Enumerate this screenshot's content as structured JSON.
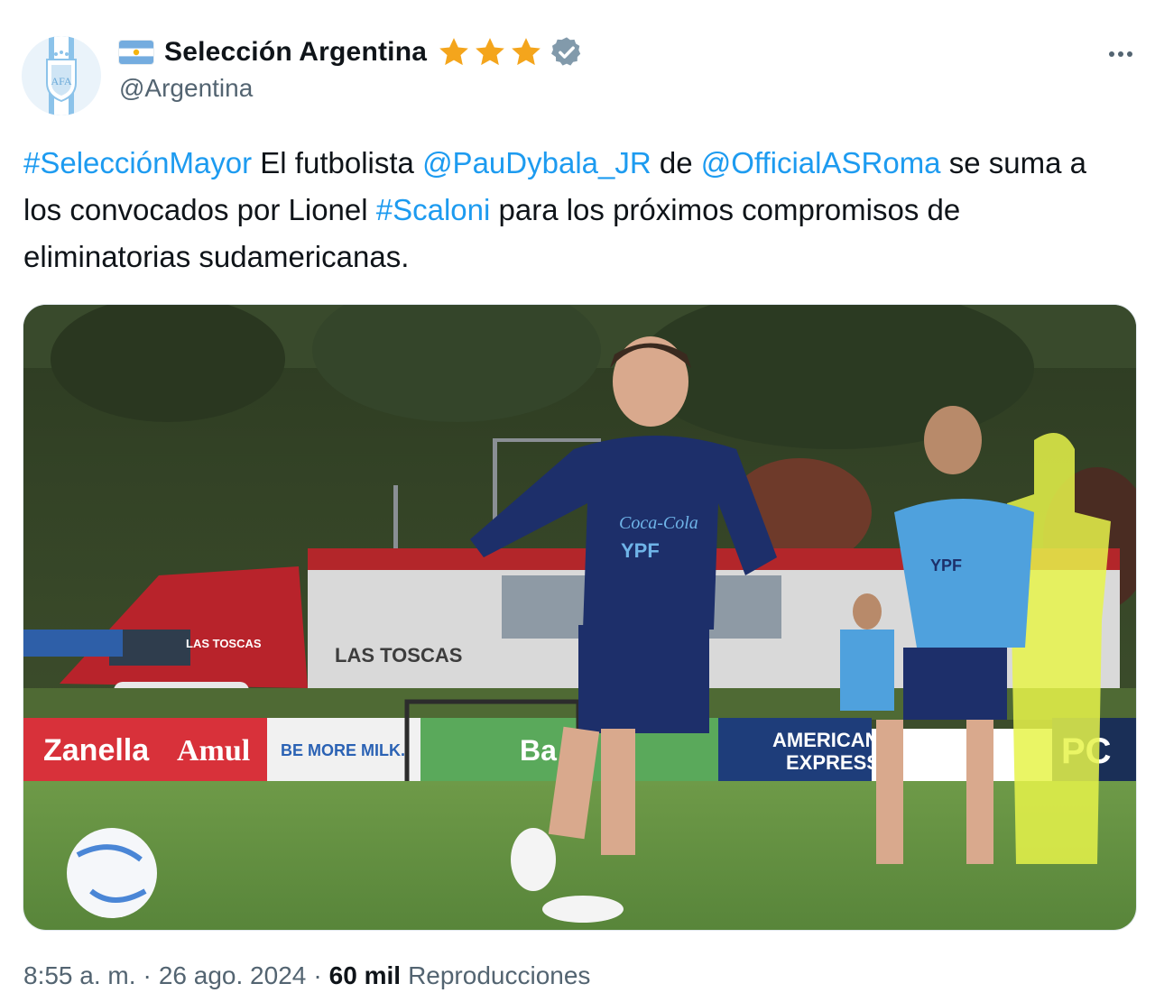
{
  "author": {
    "display_name": "Selección Argentina",
    "handle": "@Argentina",
    "avatar_icon": "afa-crest-icon",
    "flag_icon": "argentina-flag-icon",
    "stars_count": 3,
    "verified": true
  },
  "menu_icon": "more-options-icon",
  "tweet": {
    "hashtag_1": "#SelecciónMayor",
    "text_1": " El futbolista ",
    "mention_1": "@PauDybala_JR",
    "text_2": " de ",
    "mention_2": "@OfficialASRoma",
    "text_3": " se suma a los convocados por Lionel ",
    "hashtag_2": "#Scaloni",
    "text_4": " para los próximos compromisos de eliminatorias sudamericanas."
  },
  "photo": {
    "truck_text": "LAS TOSCAS",
    "truck_text_small": "LAS TOSCAS",
    "boards": [
      "Zanella",
      "Amul",
      "BE MORE MILK.",
      "Ba",
      "AMERICAN",
      "EXPRESS",
      "PC"
    ],
    "shirt_sponsor": "Coca-Cola",
    "shirt_brand": "YPF"
  },
  "footer": {
    "time": "8:55 a. m.",
    "separator": "·",
    "date": "26 ago. 2024",
    "views_count": "60 mil",
    "views_label": "Reproducciones"
  },
  "colors": {
    "link": "#1d9bf0",
    "secondary_text": "#536471",
    "star": "#f4a51c",
    "verified_badge": "#829aab"
  }
}
